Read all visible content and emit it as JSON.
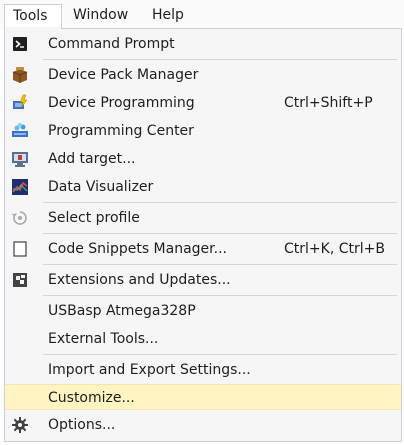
{
  "menubar": {
    "items": [
      {
        "label": "Tools",
        "active": true
      },
      {
        "label": "Window",
        "active": false
      },
      {
        "label": "Help",
        "active": false
      }
    ]
  },
  "menu": {
    "items": [
      {
        "label": "Command Prompt",
        "shortcut": "",
        "icon": "terminal-icon"
      },
      {
        "label": "Device Pack Manager",
        "shortcut": "",
        "icon": "package-icon"
      },
      {
        "label": "Device Programming",
        "shortcut": "Ctrl+Shift+P",
        "icon": "chip-lightning-icon"
      },
      {
        "label": "Programming Center",
        "shortcut": "",
        "icon": "chip-stack-icon"
      },
      {
        "label": "Add target...",
        "shortcut": "",
        "icon": "monitor-add-icon"
      },
      {
        "label": "Data Visualizer",
        "shortcut": "",
        "icon": "graph-icon"
      },
      {
        "label": "Select profile",
        "shortcut": "",
        "icon": "profile-icon"
      },
      {
        "label": "Code Snippets Manager...",
        "shortcut": "Ctrl+K, Ctrl+B",
        "icon": "snippet-icon"
      },
      {
        "label": "Extensions and Updates...",
        "shortcut": "",
        "icon": "extensions-icon"
      },
      {
        "label": "USBasp Atmega328P",
        "shortcut": "",
        "icon": ""
      },
      {
        "label": "External Tools...",
        "shortcut": "",
        "icon": ""
      },
      {
        "label": "Import and Export Settings...",
        "shortcut": "",
        "icon": ""
      },
      {
        "label": "Customize...",
        "shortcut": "",
        "icon": "",
        "highlighted": true
      },
      {
        "label": "Options...",
        "shortcut": "",
        "icon": "gear-icon"
      }
    ]
  },
  "colors": {
    "highlight": "#fff5c2",
    "menu_bg": "#f6f6f6",
    "text": "#1e1e1e"
  }
}
